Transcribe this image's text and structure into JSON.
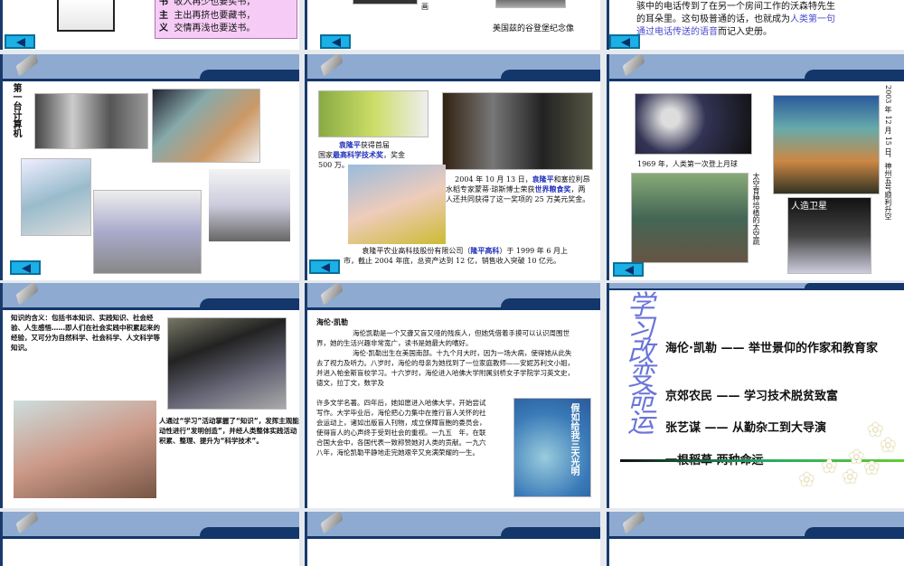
{
  "slides_top": {
    "s1_lines": [
      {
        "k": "书",
        "v": "收入再少也要买书，"
      },
      {
        "k": "主",
        "v": "主出再挤也要藏书，"
      },
      {
        "k": "义",
        "v": "交情再浅也要送书。"
      }
    ],
    "s2_small": "画",
    "s2_caption": "美国兹的谷登堡纪念像",
    "s3_line1": "骇中的电话传到了在另一个房间工作的沃森特先生",
    "s3_line2": "的耳朵里。这句极普通的话，也就成为",
    "s3_hl1": "人类第一句",
    "s3_hl2": "通过电话传送的语音",
    "s3_end": "而记入史册。"
  },
  "slide_computer": {
    "title": "第一台计算机"
  },
  "slide_yuan": {
    "c1_name": "袁隆平",
    "c1_a": "获得首届",
    "c1_b": "国家",
    "c1_award": "最高科学技术奖",
    "c1_c": "，奖金",
    "c1_d": "500 万。",
    "c2_a": "2004 年 10 月 13 日，",
    "c2_name": "袁隆平",
    "c2_b": "和塞拉利昂水稻专家蒙蒂·琼斯博士荣获",
    "c2_award": "世界粮食奖",
    "c2_c": "，两人还共同获得了这一奖项的 25 万美元奖金。",
    "c3_a": "袁隆平农业高科技股份有限公司（",
    "c3_co": "隆平高科",
    "c3_b": "）于 1999 年 6 月上市，截止 2004 年底，总资产达到 12 亿，销售收入突破 10 亿元。"
  },
  "slide_space": {
    "moon": "1969 年，人类第一次登上月球",
    "veg": "太空育种培植的太空蔬",
    "shenzhou": "2003 年 12 月 15 日，神州五号顺利升空",
    "sat": "人造卫星"
  },
  "slide_knowledge": {
    "def": "知识的含义：包括书本知识、实践知识、社会经验、人生感悟……即人们在社会实践中积累起来的经验，又可分为自然科学、社会科学、人文科学等知识。",
    "learn": "人通过“学习”活动掌握了“知识”，发挥主观能动性进行“发明创造”，并经人类整体实践活动积累、整理、提升为“科学技术”。"
  },
  "slide_keller": {
    "title": "海伦·凯勒",
    "p1": "海伦凯勒是一个又聋又盲又哑的残疾人，但她凭借着手摸可以认识周围世界，她的生活兴趣非常宽广，读书是她最大的嗜好。",
    "p2": "海伦·凯勒出生在美国南部。十九个月大时，因为一场大病，使得她从此失去了视力及听力。八岁时，海伦的母亲为她找到了一位家庭教师——安妮苏利文小姐，并进入帕金斯盲校学习。十六岁时，海伦进入哈佛大学附属剑桥女子学院学习英文史，德文，拉丁文，数学及",
    "p3": "许多文学名著。四年后，她如愿进入哈佛大学，开始尝试写作。大学毕业后，海伦把心力集中在推行盲人关怀的社会运动上，诸如出版盲人刊物，成立保障盲胞的委员会，使得盲人的心声终于受到社会的重视。一九五　年，在联合国大会中，各国代表一致称赞她对人类的贡献。一九六八年，海伦凯勒平静地走完她艰辛又充满荣耀的一生。",
    "book_title": "假如给我三天光明"
  },
  "slide_fate": {
    "vertical_title": "学习改变命运",
    "items": [
      "海伦·凯勒 —— 举世景仰的作家和教育家",
      "京郊农民 —— 学习技术脱贫致富",
      "张艺谋 —— 从勤杂工到大导演",
      "一根稻草  两种命运"
    ]
  },
  "colors": {
    "header": "#8eaad0",
    "navy": "#13366b",
    "accent": "#2233bb",
    "back": "#1bb0e6"
  }
}
